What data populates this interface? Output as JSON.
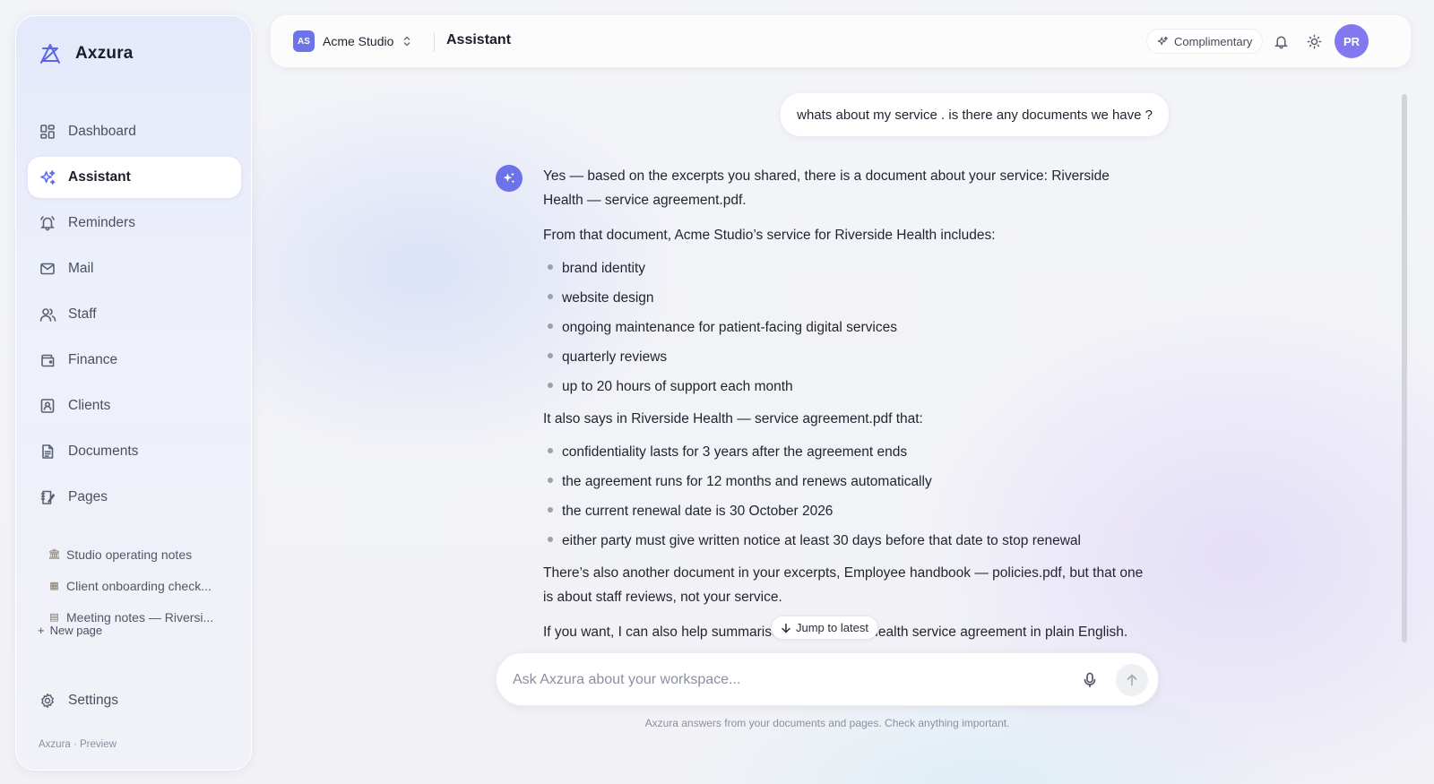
{
  "app": {
    "name": "Axzura",
    "footer": "Axzura · Preview"
  },
  "sidebar": {
    "items": [
      {
        "label": "Dashboard",
        "icon": "dashboard-icon"
      },
      {
        "label": "Assistant",
        "icon": "sparkle-icon",
        "active": true
      },
      {
        "label": "Reminders",
        "icon": "bell-icon"
      },
      {
        "label": "Mail",
        "icon": "mail-icon"
      },
      {
        "label": "Staff",
        "icon": "users-icon"
      },
      {
        "label": "Finance",
        "icon": "wallet-icon"
      },
      {
        "label": "Clients",
        "icon": "contact-icon"
      },
      {
        "label": "Documents",
        "icon": "document-icon"
      },
      {
        "label": "Pages",
        "icon": "notebook-icon"
      }
    ],
    "pages": [
      {
        "emoji": "🏛",
        "label": "Studio operating notes"
      },
      {
        "emoji": "▦",
        "label": "Client onboarding check..."
      },
      {
        "emoji": "▤",
        "label": "Meeting notes — Riversi..."
      }
    ],
    "new_page": "New page",
    "settings": "Settings"
  },
  "topbar": {
    "workspace_badge": "AS",
    "workspace_name": "Acme Studio",
    "title": "Assistant",
    "plan": "Complimentary",
    "avatar": "PR"
  },
  "chat": {
    "user_message": "whats about my service . is there any documents we have ?",
    "ai": {
      "p1": "Yes — based on the excerpts you shared, there is a document about your service: Riverside Health — service agreement.pdf.",
      "p2": "From that document, Acme Studio’s service for Riverside Health includes:",
      "list1": [
        "brand identity",
        "website design",
        "ongoing maintenance for patient-facing digital services",
        "quarterly reviews",
        "up to 20 hours of support each month"
      ],
      "p3": "It also says in Riverside Health — service agreement.pdf that:",
      "list2": [
        "confidentiality lasts for 3 years after the agreement ends",
        "the agreement runs for 12 months and renews automatically",
        "the current renewal date is 30 October 2026",
        "either party must give written notice at least 30 days before that date to stop renewal"
      ],
      "p4": "There’s also another document in your excerpts, Employee handbook — policies.pdf, but that one is about staff reviews, not your service.",
      "p5": "If you want, I can also help summarise the Riverside Health service agreement in plain English."
    },
    "jump_label": "Jump to latest",
    "composer_placeholder": "Ask Axzura about your workspace...",
    "composer_value": "",
    "disclaimer": "Axzura answers from your documents and pages. Check anything important."
  },
  "colors": {
    "accent": "#6c73e8",
    "avatar": "#8378ee"
  }
}
